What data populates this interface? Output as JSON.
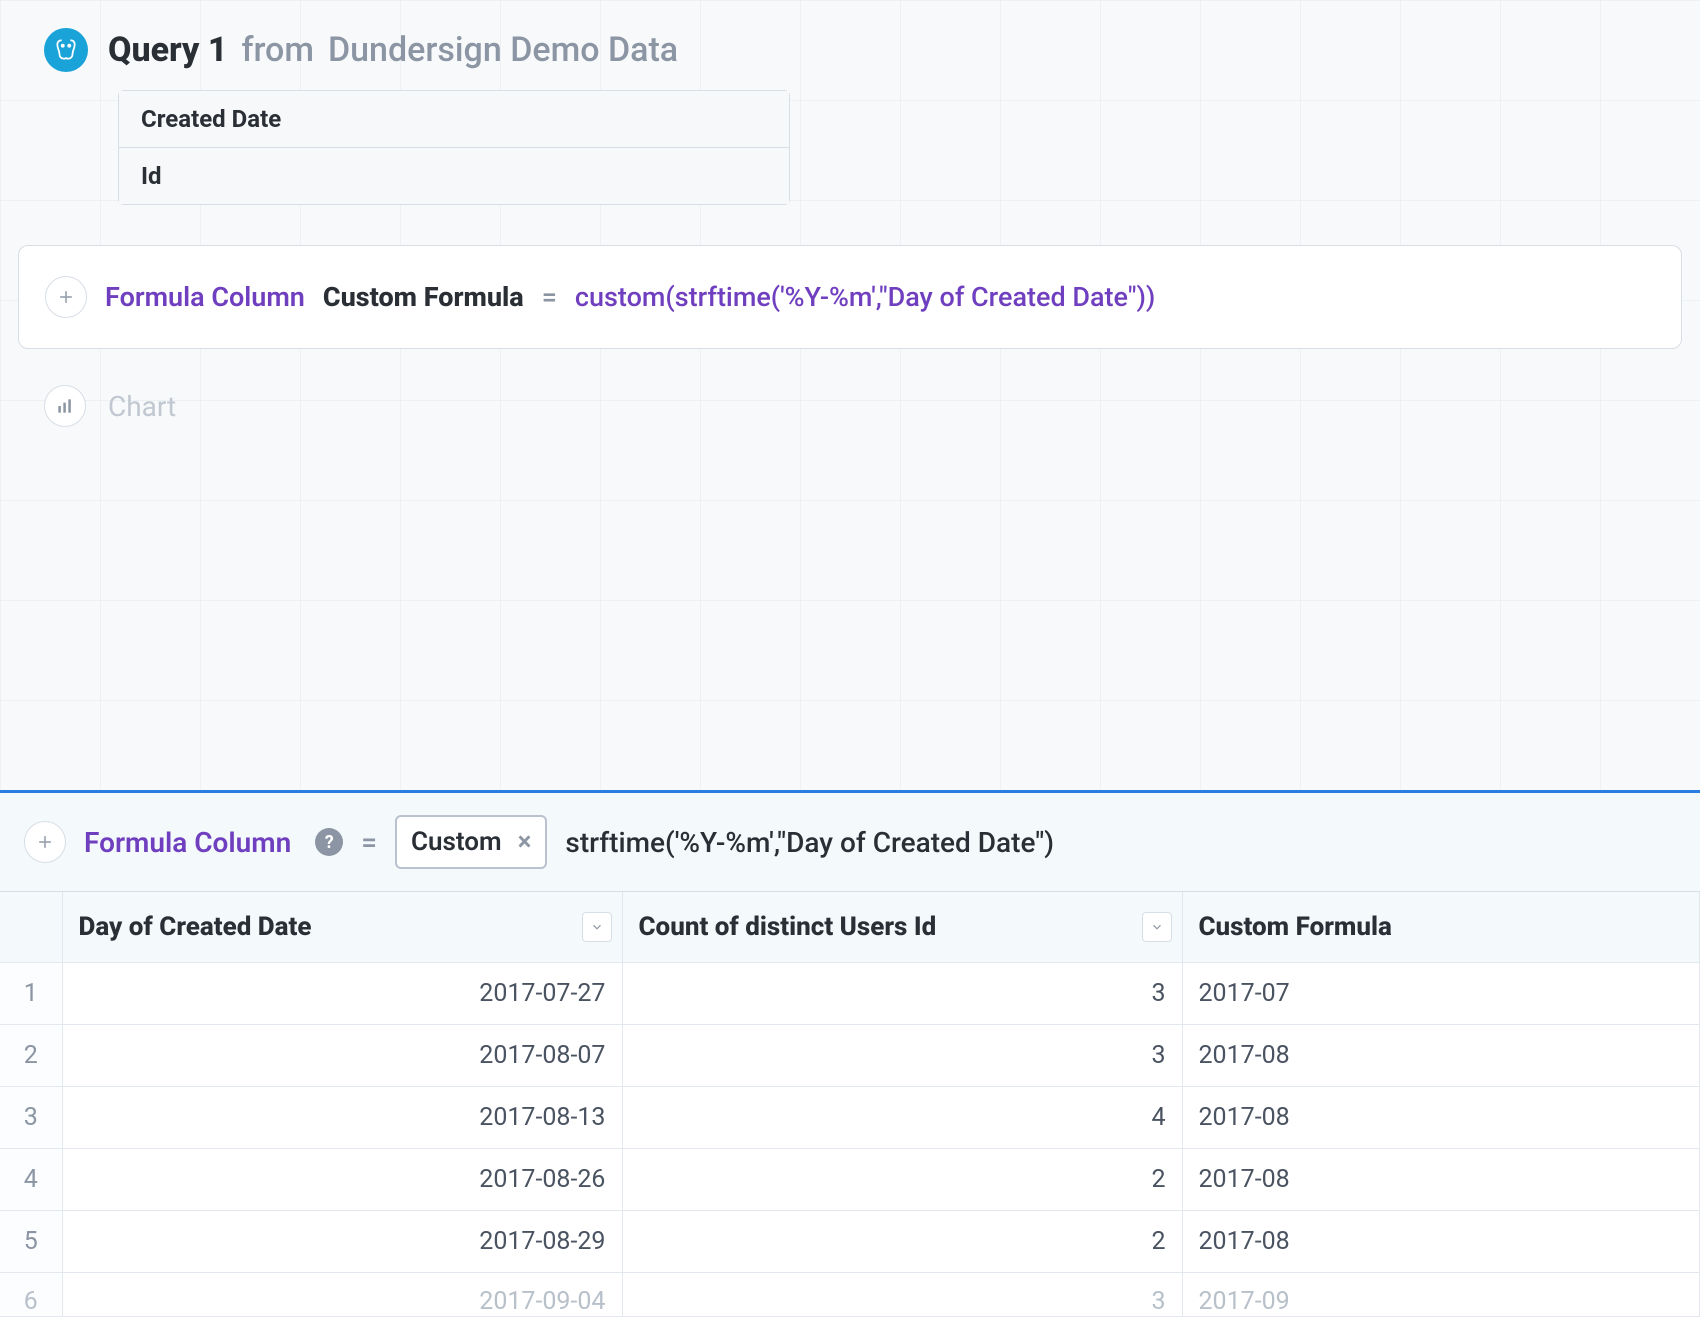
{
  "query": {
    "title": "Query 1",
    "from_prefix": "from",
    "source": "Dundersign Demo Data",
    "columns": [
      "Created Date",
      "Id"
    ]
  },
  "formula_card": {
    "label": "Formula Column",
    "name": "Custom Formula",
    "equals": "=",
    "expression": "custom(strftime('%Y-%m',\"Day of Created Date\"))"
  },
  "chart_step": {
    "label": "Chart"
  },
  "formula_bar": {
    "label": "Formula Column",
    "help": "?",
    "equals": "=",
    "pill_label": "Custom",
    "pill_close": "×",
    "expression": "strftime('%Y-%m',\"Day of Created Date\")"
  },
  "table": {
    "headers": {
      "c1": "Day of Created Date",
      "c2": "Count of distinct Users Id",
      "c3": "Custom Formula"
    },
    "rows": [
      {
        "n": "1",
        "date": "2017-07-27",
        "count": "3",
        "formula": "2017-07"
      },
      {
        "n": "2",
        "date": "2017-08-07",
        "count": "3",
        "formula": "2017-08"
      },
      {
        "n": "3",
        "date": "2017-08-13",
        "count": "4",
        "formula": "2017-08"
      },
      {
        "n": "4",
        "date": "2017-08-26",
        "count": "2",
        "formula": "2017-08"
      },
      {
        "n": "5",
        "date": "2017-08-29",
        "count": "2",
        "formula": "2017-08"
      },
      {
        "n": "6",
        "date": "2017-09-04",
        "count": "3",
        "formula": "2017-09"
      }
    ]
  }
}
